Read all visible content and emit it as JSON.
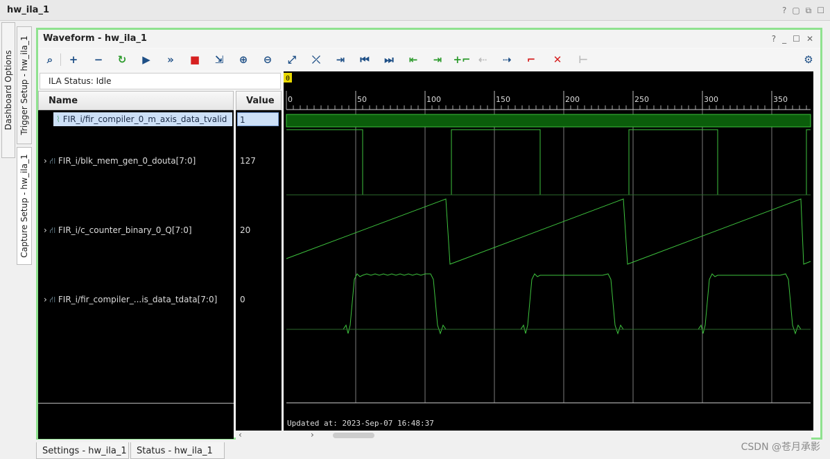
{
  "window": {
    "title": "hw_ila_1"
  },
  "side_tabs": [
    "Dashboard Options",
    "Trigger Setup - hw_ila_1",
    "Capture Setup - hw_ila_1"
  ],
  "waveform": {
    "title": "Waveform - hw_ila_1",
    "ila_status": "ILA Status:  Idle",
    "columns": {
      "name": "Name",
      "value": "Value"
    },
    "signals": [
      {
        "name": "FIR_i/fir_compiler_0_m_axis_data_tvalid",
        "value": "1"
      },
      {
        "name": "FIR_i/blk_mem_gen_0_douta[7:0]",
        "value": "127"
      },
      {
        "name": "FIR_i/c_counter_binary_0_Q[7:0]",
        "value": "20"
      },
      {
        "name": "FIR_i/fir_compiler_...is_data_tdata[7:0]",
        "value": "0"
      }
    ],
    "cursor_marker": "0",
    "time_ticks": [
      "0",
      "50",
      "100",
      "150",
      "200",
      "250",
      "300",
      "350"
    ],
    "updated_at": "Updated at: 2023-Sep-07 16:48:37",
    "colors": {
      "wave": "#3ec43e",
      "grid": "#cfcfcf",
      "bg": "#000000",
      "accent_border": "#8fe28f"
    }
  },
  "bottom_tabs": [
    "Settings - hw_ila_1",
    "Status - hw_ila_1"
  ],
  "watermark": "CSDN @苍月承影"
}
